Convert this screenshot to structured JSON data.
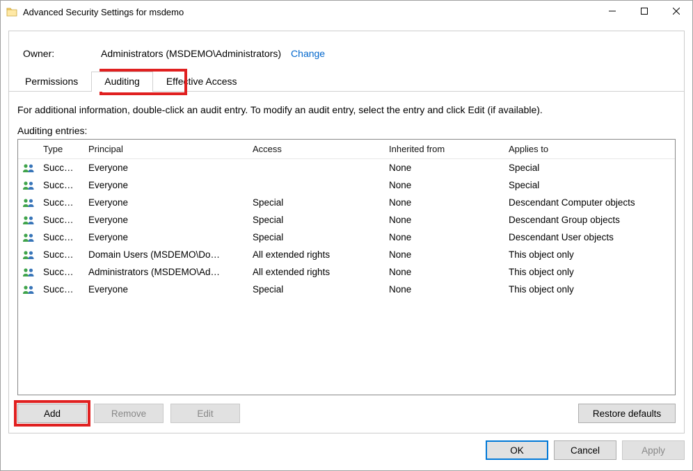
{
  "window": {
    "title": "Advanced Security Settings for msdemo"
  },
  "owner": {
    "label": "Owner:",
    "value": "Administrators (MSDEMO\\Administrators)",
    "change": "Change"
  },
  "tabs": {
    "permissions": "Permissions",
    "auditing": "Auditing",
    "effective_access": "Effective Access",
    "active": "auditing"
  },
  "body": {
    "info": "For additional information, double-click an audit entry. To modify an audit entry, select the entry and click Edit (if available).",
    "entries_label": "Auditing entries:"
  },
  "columns": {
    "type": "Type",
    "principal": "Principal",
    "access": "Access",
    "inherited": "Inherited from",
    "applies": "Applies to"
  },
  "rows": [
    {
      "type": "Succ…",
      "principal": "Everyone",
      "access": "",
      "inherited": "None",
      "applies": "Special"
    },
    {
      "type": "Succ…",
      "principal": "Everyone",
      "access": "",
      "inherited": "None",
      "applies": "Special"
    },
    {
      "type": "Succ…",
      "principal": "Everyone",
      "access": "Special",
      "inherited": "None",
      "applies": "Descendant Computer objects"
    },
    {
      "type": "Succ…",
      "principal": "Everyone",
      "access": "Special",
      "inherited": "None",
      "applies": "Descendant Group objects"
    },
    {
      "type": "Succ…",
      "principal": "Everyone",
      "access": "Special",
      "inherited": "None",
      "applies": "Descendant User objects"
    },
    {
      "type": "Succ…",
      "principal": "Domain Users (MSDEMO\\Do…",
      "access": "All extended rights",
      "inherited": "None",
      "applies": "This object only"
    },
    {
      "type": "Succ…",
      "principal": "Administrators (MSDEMO\\Ad…",
      "access": "All extended rights",
      "inherited": "None",
      "applies": "This object only"
    },
    {
      "type": "Succ…",
      "principal": "Everyone",
      "access": "Special",
      "inherited": "None",
      "applies": "This object only"
    }
  ],
  "buttons": {
    "add": "Add",
    "remove": "Remove",
    "edit": "Edit",
    "restore": "Restore defaults",
    "ok": "OK",
    "cancel": "Cancel",
    "apply": "Apply"
  }
}
